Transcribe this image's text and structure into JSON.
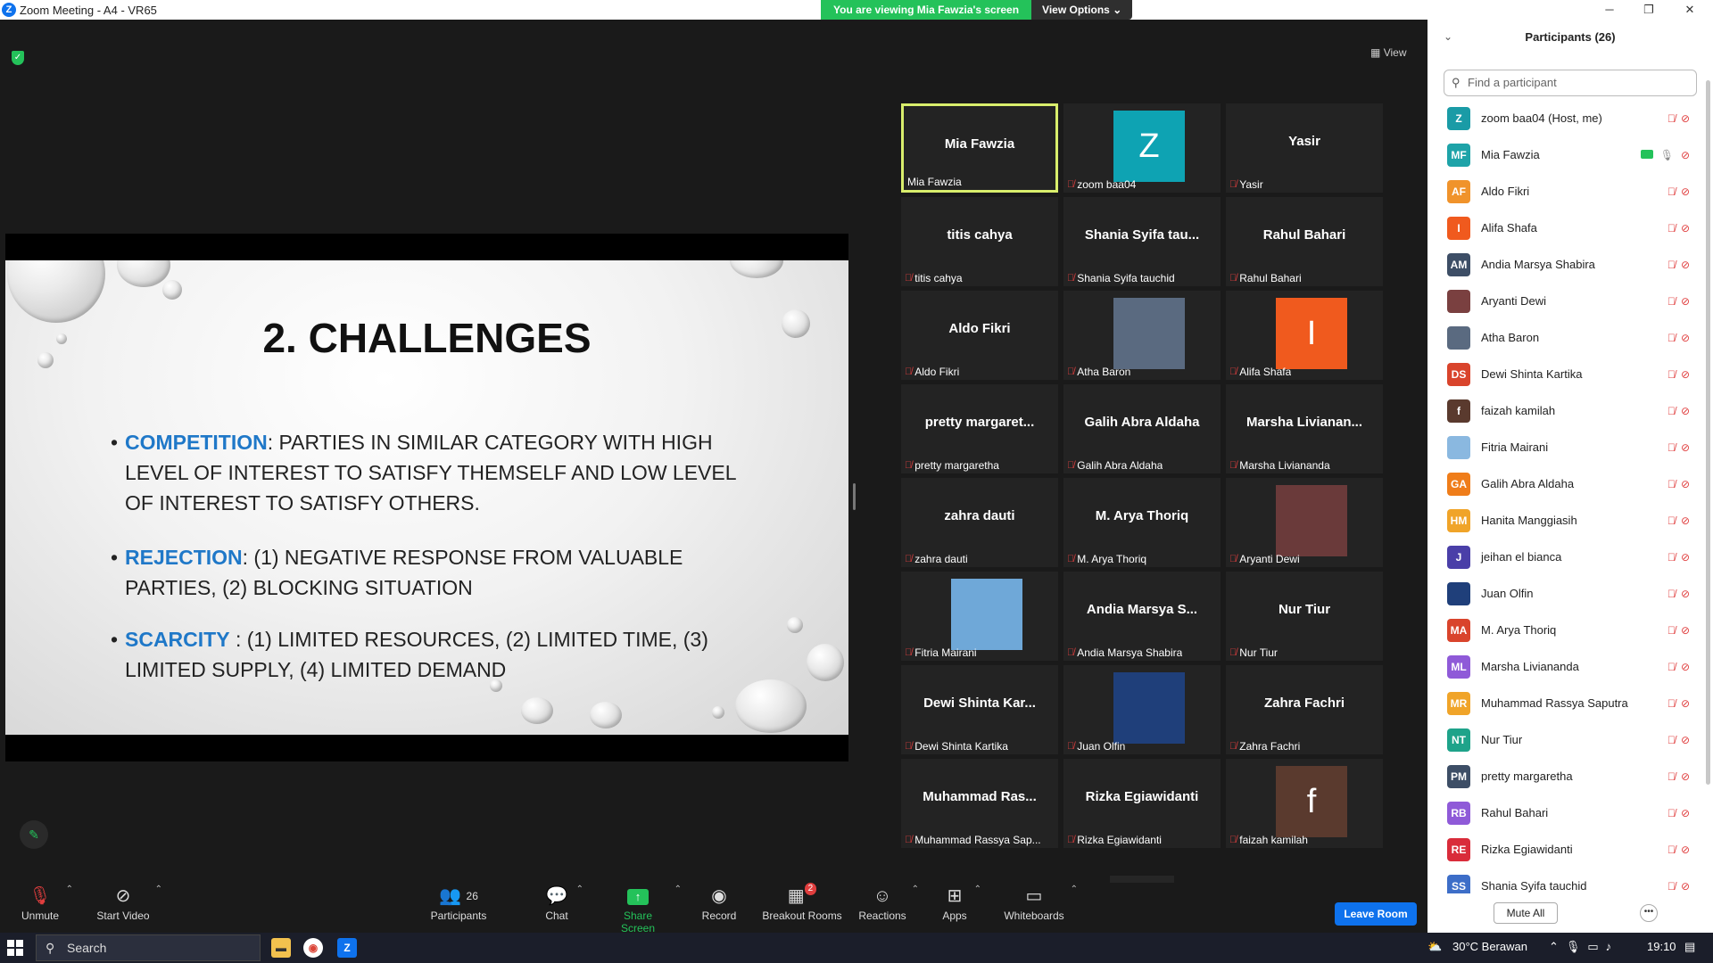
{
  "window": {
    "title": "Zoom Meeting - A4 - VR65"
  },
  "banner": {
    "viewing": "You are viewing Mia Fawzia's screen",
    "view_options": "View Options"
  },
  "view_label": "View",
  "slide": {
    "title": "2. CHALLENGES",
    "bullets": [
      {
        "keyword": "COMPETITION",
        "sep": ": ",
        "text": "PARTIES IN SIMILAR CATEGORY WITH HIGH LEVEL OF INTEREST TO SATISFY THEMSELF AND LOW LEVEL OF INTEREST TO SATISFY OTHERS."
      },
      {
        "keyword": "REJECTION",
        "sep": ": ",
        "text": "(1) NEGATIVE RESPONSE FROM VALUABLE PARTIES, (2) BLOCKING SITUATION"
      },
      {
        "keyword": "SCARCITY",
        "sep": " : ",
        "text": "(1) LIMITED RESOURCES, (2) LIMITED TIME, (3) LIMITED SUPPLY, (4) LIMITED DEMAND"
      }
    ]
  },
  "gallery": [
    {
      "big": "Mia Fawzia",
      "label": "Mia Fawzia",
      "avatar": "",
      "active": true
    },
    {
      "big": "",
      "label": "zoom baa04",
      "avatar": "Z",
      "avatar_color": "#0ea3b3"
    },
    {
      "big": "Yasir",
      "label": "Yasir",
      "avatar": ""
    },
    {
      "big": "titis cahya",
      "label": "titis cahya",
      "avatar": ""
    },
    {
      "big": "Shania Syifa tau...",
      "label": "Shania Syifa tauchid",
      "avatar": ""
    },
    {
      "big": "Rahul Bahari",
      "label": "Rahul Bahari",
      "avatar": ""
    },
    {
      "big": "Aldo Fikri",
      "label": "Aldo Fikri",
      "avatar": ""
    },
    {
      "big": "",
      "label": "Atha Baron",
      "avatar": "",
      "avatar_color": "#5a6a80",
      "photo": true
    },
    {
      "big": "",
      "label": "Alifa Shafa",
      "avatar": "I",
      "avatar_color": "#f05a1e"
    },
    {
      "big": "pretty margaret...",
      "label": "pretty margaretha",
      "avatar": ""
    },
    {
      "big": "Galih Abra Aldaha",
      "label": "Galih Abra Aldaha",
      "avatar": ""
    },
    {
      "big": "Marsha Livianan...",
      "label": "Marsha Liviananda",
      "avatar": ""
    },
    {
      "big": "zahra dauti",
      "label": "zahra dauti",
      "avatar": ""
    },
    {
      "big": "M. Arya Thoriq",
      "label": "M. Arya Thoriq",
      "avatar": ""
    },
    {
      "big": "",
      "label": "Aryanti Dewi",
      "avatar": "",
      "avatar_color": "#6a3a3a",
      "photo": true
    },
    {
      "big": "",
      "label": "Fitria Mairani",
      "avatar": "",
      "avatar_color": "#6fa8d8",
      "photo": true
    },
    {
      "big": "Andia Marsya S...",
      "label": "Andia Marsya Shabira",
      "avatar": ""
    },
    {
      "big": "Nur Tiur",
      "label": "Nur Tiur",
      "avatar": ""
    },
    {
      "big": "Dewi Shinta Kar...",
      "label": "Dewi Shinta Kartika",
      "avatar": ""
    },
    {
      "big": "",
      "label": "Juan Olfin",
      "avatar": "",
      "avatar_color": "#1f3f7a",
      "photo": true
    },
    {
      "big": "Zahra Fachri",
      "label": "Zahra Fachri",
      "avatar": ""
    },
    {
      "big": "Muhammad Ras...",
      "label": "Muhammad Rassya Sap...",
      "avatar": ""
    },
    {
      "big": "Rizka Egiawidanti",
      "label": "Rizka Egiawidanti",
      "avatar": ""
    },
    {
      "big": "",
      "label": "faizah kamilah",
      "avatar": "f",
      "avatar_color": "#5a3a2e"
    }
  ],
  "toolbar": {
    "unmute": "Unmute",
    "start_video": "Start Video",
    "participants": "Participants",
    "participants_count": "26",
    "chat": "Chat",
    "share_screen": "Share Screen",
    "record": "Record",
    "breakout": "Breakout Rooms",
    "breakout_badge": "2",
    "reactions": "Reactions",
    "apps": "Apps",
    "whiteboards": "Whiteboards",
    "leave": "Leave Room"
  },
  "panel": {
    "title": "Participants (26)",
    "search_placeholder": "Find a participant",
    "mute_all": "Mute All",
    "participants": [
      {
        "initials": "Z",
        "name": "zoom baa04 (Host, me)",
        "color": "#1a9ba6"
      },
      {
        "initials": "MF",
        "name": "Mia Fawzia",
        "color": "#1ea3a8",
        "sharing": true
      },
      {
        "initials": "AF",
        "name": "Aldo Fikri",
        "color": "#f0932b"
      },
      {
        "initials": "I",
        "name": "Alifa Shafa",
        "color": "#f05a1e"
      },
      {
        "initials": "AM",
        "name": "Andia Marsya Shabira",
        "color": "#3d4e66"
      },
      {
        "initials": "",
        "name": "Aryanti Dewi",
        "color": "#7a4040"
      },
      {
        "initials": "",
        "name": "Atha Baron",
        "color": "#5a6a80"
      },
      {
        "initials": "DS",
        "name": "Dewi Shinta Kartika",
        "color": "#d9442c"
      },
      {
        "initials": "f",
        "name": "faizah kamilah",
        "color": "#5a3a2e"
      },
      {
        "initials": "",
        "name": "Fitria Mairani",
        "color": "#8ab8e0"
      },
      {
        "initials": "GA",
        "name": "Galih Abra Aldaha",
        "color": "#ef7d1a"
      },
      {
        "initials": "HM",
        "name": "Hanita Manggiasih",
        "color": "#f0a429"
      },
      {
        "initials": "J",
        "name": "jeihan el bianca",
        "color": "#4a3fa8"
      },
      {
        "initials": "",
        "name": "Juan Olfin",
        "color": "#1f3f7a"
      },
      {
        "initials": "MA",
        "name": "M. Arya Thoriq",
        "color": "#d9442c"
      },
      {
        "initials": "ML",
        "name": "Marsha Liviananda",
        "color": "#8f5ad8"
      },
      {
        "initials": "MR",
        "name": "Muhammad Rassya Saputra",
        "color": "#f0a429"
      },
      {
        "initials": "NT",
        "name": "Nur Tiur",
        "color": "#1ea38a"
      },
      {
        "initials": "PM",
        "name": "pretty margaretha",
        "color": "#3d4e66"
      },
      {
        "initials": "RB",
        "name": "Rahul Bahari",
        "color": "#8f5ad8"
      },
      {
        "initials": "RE",
        "name": "Rizka Egiawidanti",
        "color": "#d92c3a"
      },
      {
        "initials": "SS",
        "name": "Shania Syifa tauchid",
        "color": "#3d6ec8"
      }
    ]
  },
  "taskbar": {
    "search": "Search",
    "weather": "30°C Berawan",
    "time": "19:10"
  }
}
